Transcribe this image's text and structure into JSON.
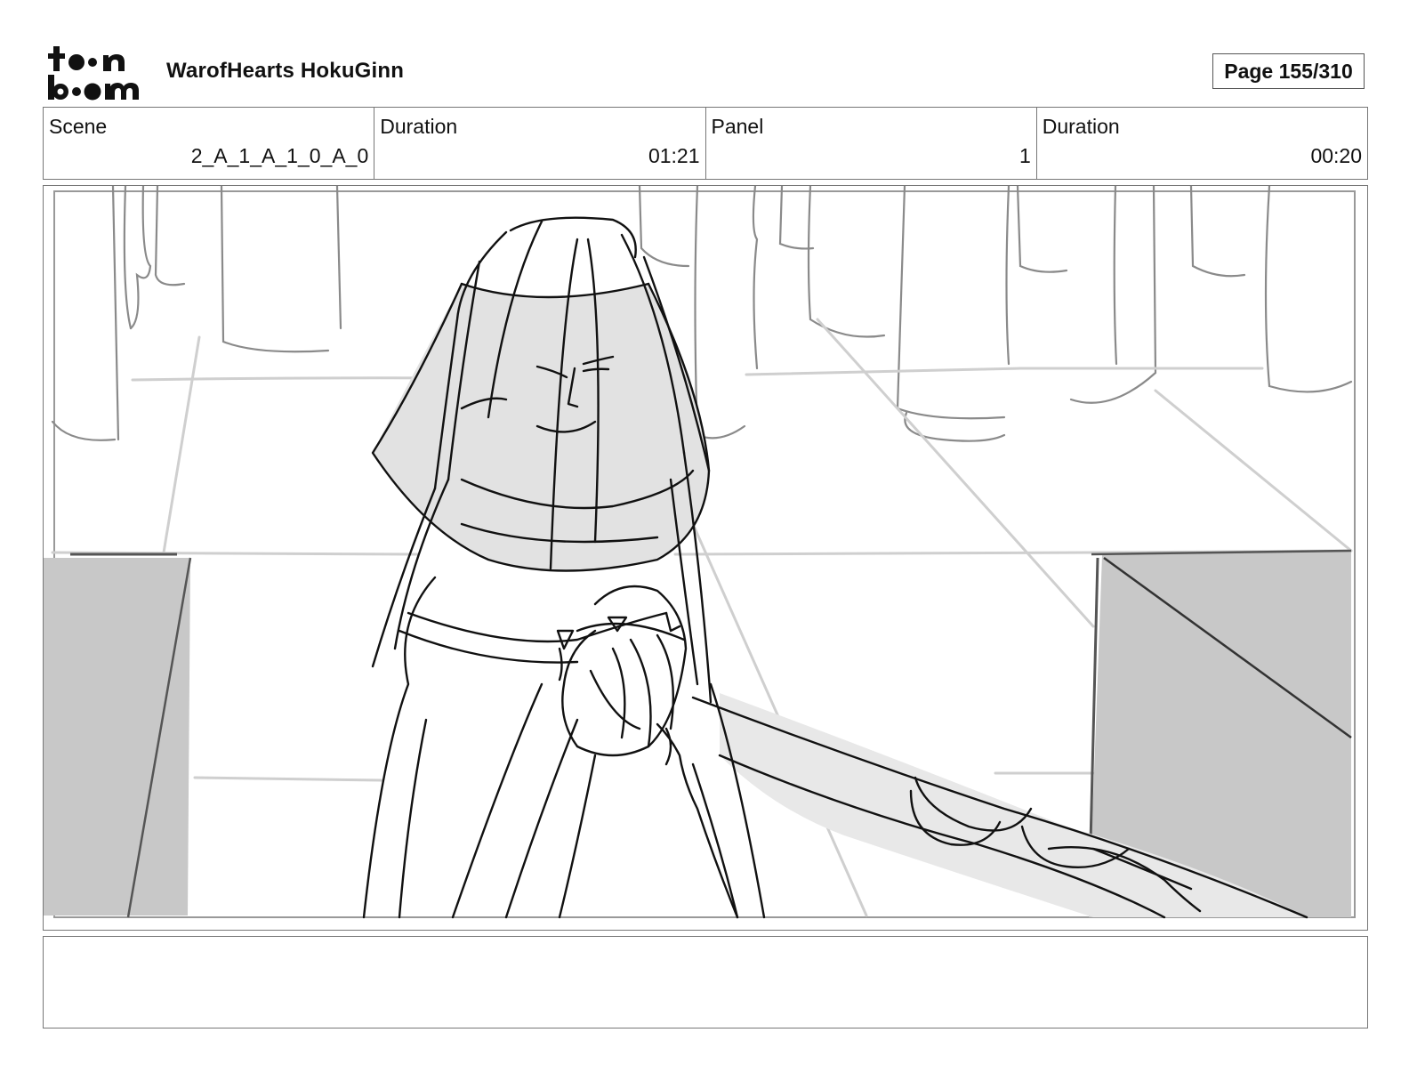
{
  "header": {
    "logo": {
      "icon": "toonboom-logo",
      "line1": "t••n",
      "line2": "b••m"
    },
    "project_title": "WarofHearts HokuGinn",
    "page_indicator": "Page 155/310"
  },
  "info": {
    "scene": {
      "label": "Scene",
      "value": "2_A_1_A_1_0_A_0"
    },
    "scene_duration": {
      "label": "Duration",
      "value": "01:21"
    },
    "panel": {
      "label": "Panel",
      "value": "1"
    },
    "panel_duration": {
      "label": "Duration",
      "value": "00:20"
    }
  },
  "panel_image": {
    "icon": "storyboard-sketch",
    "description_shown": false
  },
  "caption": {
    "text": ""
  },
  "colors": {
    "border": "#777777",
    "sketch_line": "#111111",
    "sketch_fill_light": "#e2e2e2",
    "sketch_fill_dark": "#c8c8c8",
    "background_line": "#8a8a8a"
  }
}
